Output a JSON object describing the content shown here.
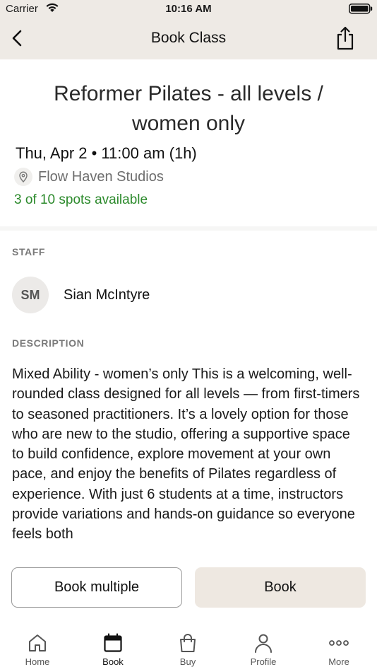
{
  "status_bar": {
    "carrier": "Carrier",
    "time": "10:16 AM"
  },
  "header": {
    "title": "Book Class",
    "back_icon": "chevron-left-icon",
    "share_icon": "share-icon"
  },
  "class_info": {
    "title": "Reformer Pilates - all levels / women only",
    "datetime": "Thu, Apr 2 • 11:00 am (1h)",
    "location": "Flow Haven Studios",
    "spots": "3 of 10 spots available"
  },
  "staff": {
    "label": "STAFF",
    "initials": "SM",
    "name": "Sian McIntyre"
  },
  "description": {
    "label": "DESCRIPTION",
    "text": "Mixed Ability - women’s only This is a welcoming, well-rounded class designed for all levels — from first-timers to seasoned practitioners. It’s a lovely option for those who are new to the studio, offering a supportive space to build confidence, explore movement at your own pace, and enjoy the benefits of Pilates regardless of experience. With just 6 students at a time, instructors provide variations and hands-on guidance so everyone feels both"
  },
  "actions": {
    "book_multiple": "Book multiple",
    "book": "Book"
  },
  "tabbar": {
    "items": [
      {
        "label": "Home",
        "icon": "home-icon"
      },
      {
        "label": "Book",
        "icon": "calendar-icon"
      },
      {
        "label": "Buy",
        "icon": "shopping-bag-icon"
      },
      {
        "label": "Profile",
        "icon": "person-icon"
      },
      {
        "label": "More",
        "icon": "more-dots-icon"
      }
    ],
    "active": "Book"
  },
  "colors": {
    "header_bg": "#eeeae5",
    "available_green": "#2c8a2c",
    "book_button_bg": "#eee8e1"
  }
}
